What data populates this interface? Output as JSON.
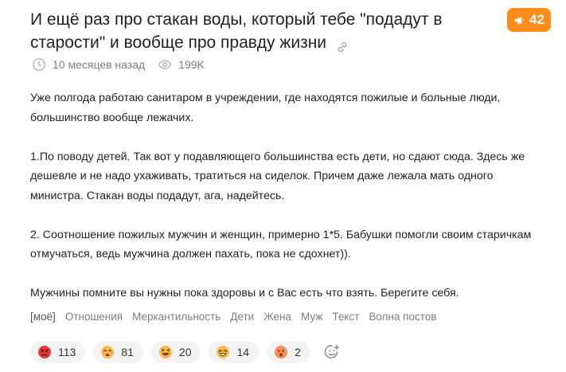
{
  "post": {
    "title": "И ещё раз про стакан воды, который тебе \"подадут в старости\" и вообще про правду жизни",
    "rating": "42",
    "meta": {
      "time": "10 месяцев назад",
      "views": "199K"
    },
    "paragraphs": [
      "Уже полгода работаю санитаром в учреждении, где находятся пожилые и больные люди, большинство вообще лежачих.",
      "1.По поводу детей. Так вот у подавляющего большинства есть дети, но сдают сюда. Здесь же дешевле и не надо ухаживать, тратиться на сиделок. Причем даже лежала мать одного министра. Стакан воды подадут, ага, надейтесь.",
      "2. Соотношение пожилых мужчин и женщин, примерно 1*5. Бабушки помогли своим старичкам отмучаться, ведь мужчина должен пахать, пока не сдохнет)).",
      "Мужчины помните вы нужны пока здоровы и с Вас есть что взять. Берегите себя."
    ],
    "tags": [
      "[моё]",
      "Отношения",
      "Меркантильность",
      "Дети",
      "Жена",
      "Муж",
      "Текст",
      "Волна постов"
    ],
    "reactions": [
      {
        "icon": "angry-face-icon",
        "count": "113",
        "color": "#e53935"
      },
      {
        "icon": "sad-face-icon",
        "count": "81",
        "color": "#ffb74d"
      },
      {
        "icon": "laughing-face-icon",
        "count": "20",
        "color": "#ffb74d"
      },
      {
        "icon": "smiling-face-icon",
        "count": "14",
        "color": "#ffb74d"
      },
      {
        "icon": "surprised-face-icon",
        "count": "2",
        "color": "#ff8a50"
      }
    ],
    "colors": {
      "accent": "#ff8c1a",
      "muted": "#7d7d7d",
      "chip": "#f3f3f3"
    }
  }
}
